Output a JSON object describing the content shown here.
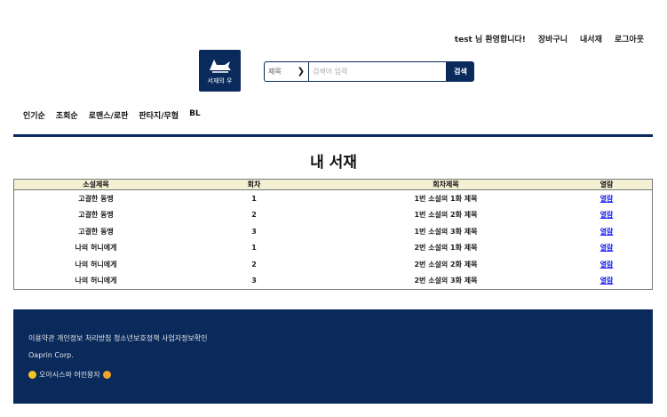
{
  "header": {
    "links": [
      "test 님 환영합니다!",
      "장바구니",
      "내서재",
      "로그아웃"
    ],
    "logo_text": "서재의 우"
  },
  "search": {
    "select_value": "제목",
    "placeholder": "검색어 입력",
    "button_label": "검색"
  },
  "nav": {
    "items": [
      "인기순",
      "조회순",
      "로맨스/로판",
      "판타지/무협",
      "BL"
    ]
  },
  "page_title": "내 서재",
  "table": {
    "headers": [
      "소설제목",
      "회차",
      "회차제목",
      "열람"
    ],
    "rows": [
      [
        "고결한 동맹",
        "1",
        "1번 소설의 1화 제목",
        "열람"
      ],
      [
        "고결한 동맹",
        "2",
        "1번 소설의 2화 제목",
        "열람"
      ],
      [
        "고결한 동맹",
        "3",
        "1번 소설의 3화 제목",
        "열람"
      ],
      [
        "나의 허니에게",
        "1",
        "2번 소설의 1화 제목",
        "열람"
      ],
      [
        "나의 허니에게",
        "2",
        "2번 소설의 2화 제목",
        "열람"
      ],
      [
        "나의 허니에게",
        "3",
        "2번 소설의 3화 제목",
        "열람"
      ]
    ]
  },
  "footer": {
    "links": "이용약관 개인정보 처리방침 청소년보호정책 사업자정보확인",
    "corp": "Oaprin Corp.",
    "credit": "오아시스와 어린왕자"
  },
  "colors": {
    "brand": "#0a2a5c",
    "table_header": "#f4f0d4",
    "link": "#1a1aee"
  }
}
